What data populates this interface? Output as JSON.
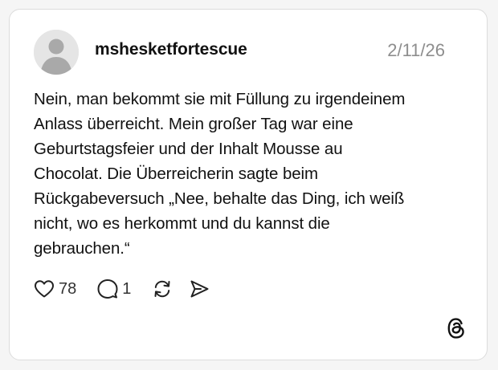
{
  "post": {
    "username": "mshesketfortescue",
    "date": "2/11/26",
    "text": "Nein, man bekommt sie mit Füllung zu irgendeinem\nAnlass überreicht. Mein großer Tag war eine\nGeburtstagsfeier und der Inhalt Mousse au\nChocolat. Die Überreicherin sagte beim\nRückgabeversuch „Nee, behalte das Ding, ich weiß\nnicht, wo es herkommt und du kannst die\ngebrauchen.“"
  },
  "actions": {
    "likes": "78",
    "replies": "1"
  },
  "icons": {
    "avatar": "default-avatar-icon",
    "like": "heart-icon",
    "reply": "comment-bubble-icon",
    "repost": "repost-icon",
    "share": "send-icon",
    "brand": "threads-logo-icon"
  },
  "colors": {
    "text": "#111111",
    "muted": "#8e8e8e",
    "border": "#dcdcdc",
    "avatar_bg": "#e5e5e5",
    "avatar_fg": "#a9a9a9"
  }
}
